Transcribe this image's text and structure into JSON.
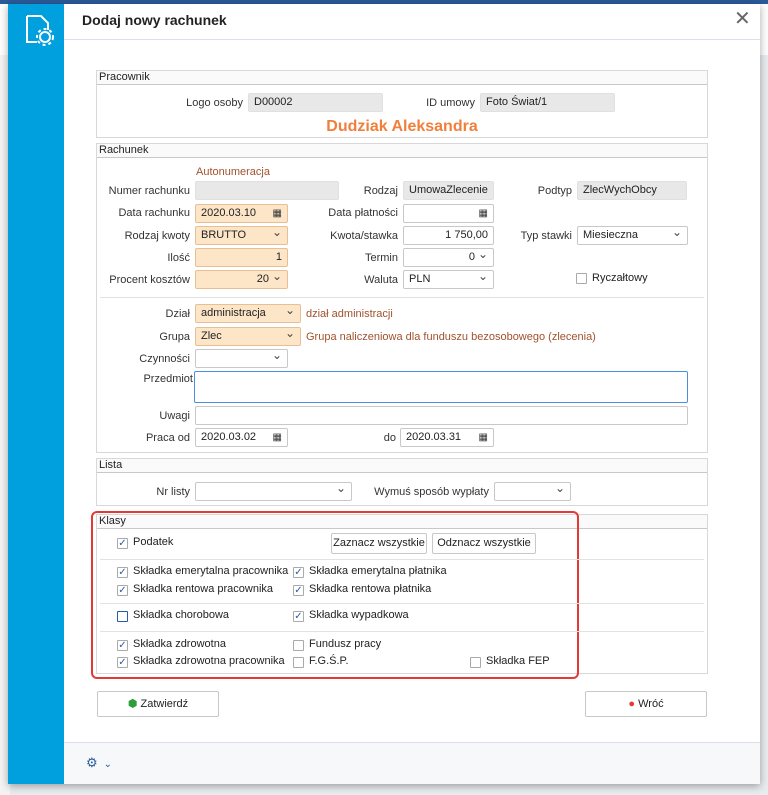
{
  "dialog": {
    "title": "Dodaj nowy rachunek",
    "close_icon": "close-icon",
    "app_icon": "document-gear-icon"
  },
  "pracownik": {
    "header": "Pracownik",
    "logo_label": "Logo osoby",
    "logo_value": "D00002",
    "id_label": "ID umowy",
    "id_value": "Foto Świat/1",
    "name": "Dudziak Aleksandra"
  },
  "rachunek": {
    "header": "Rachunek",
    "autonum": "Autonumeracja",
    "numer_label": "Numer rachunku",
    "numer_value": "",
    "rodzaj_label": "Rodzaj",
    "rodzaj_value": "UmowaZlecenie",
    "podtyp_label": "Podtyp",
    "podtyp_value": "ZlecWychObcy",
    "data_label": "Data rachunku",
    "data_value": "2020.03.10",
    "platnosc_label": "Data płatności",
    "platnosc_value": "",
    "kwoty_label": "Rodzaj kwoty",
    "kwoty_value": "BRUTTO",
    "kwota_label": "Kwota/stawka",
    "kwota_value": "1 750,00",
    "typ_label": "Typ stawki",
    "typ_value": "Miesieczna",
    "ilosc_label": "Ilość",
    "ilosc_value": "1",
    "termin_label": "Termin",
    "termin_value": "0",
    "procent_label": "Procent kosztów",
    "procent_value": "20",
    "waluta_label": "Waluta",
    "waluta_value": "PLN",
    "ryczaltowy_label": "Ryczałtowy",
    "ryczaltowy_checked": false,
    "dzial_label": "Dział",
    "dzial_value": "administracja",
    "dzial_desc": "dział administracji",
    "grupa_label": "Grupa",
    "grupa_value": "Zlec",
    "grupa_desc": "Grupa naliczeniowa dla funduszu bezosobowego (zlecenia)",
    "czynnosci_label": "Czynności",
    "czynnosci_value": "",
    "przedmiot_label": "Przedmiot",
    "przedmiot_value": "",
    "uwagi_label": "Uwagi",
    "uwagi_value": "",
    "praca_od_label": "Praca od",
    "praca_od_value": "2020.03.02",
    "do_label": "do",
    "do_value": "2020.03.31"
  },
  "lista": {
    "header": "Lista",
    "nr_label": "Nr listy",
    "nr_value": "",
    "wymus_label": "Wymuś sposób wypłaty",
    "wymus_value": ""
  },
  "klasy": {
    "header": "Klasy",
    "select_all": "Zaznacz wszystkie",
    "deselect_all": "Odznacz wszystkie",
    "items": [
      {
        "label": "Podatek",
        "checked": true
      },
      {
        "label": "Składka emerytalna pracownika",
        "checked": true
      },
      {
        "label": "Składka emerytalna płatnika",
        "checked": true
      },
      {
        "label": "Składka rentowa pracownika",
        "checked": true
      },
      {
        "label": "Składka rentowa płatnika",
        "checked": true
      },
      {
        "label": "Składka chorobowa",
        "checked": false
      },
      {
        "label": "Składka wypadkowa",
        "checked": true
      },
      {
        "label": "Składka zdrowotna",
        "checked": true
      },
      {
        "label": "Fundusz pracy",
        "checked": false
      },
      {
        "label": "Składka zdrowotna pracownika",
        "checked": true
      },
      {
        "label": "F.G.Ś.P.",
        "checked": false
      },
      {
        "label": "Składka FEP",
        "checked": false
      }
    ]
  },
  "actions": {
    "confirm": "Zatwierdź",
    "back": "Wróć"
  },
  "colors": {
    "accent": "#00a0df",
    "name": "#f07f3c",
    "highlight_red": "#e53935"
  }
}
